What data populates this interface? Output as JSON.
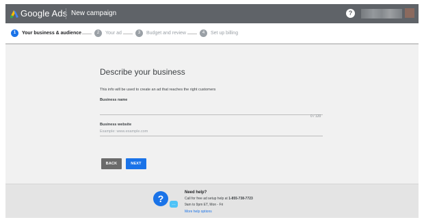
{
  "appbar": {
    "brand": "Google Ads",
    "campaign": "New campaign",
    "help_glyph": "?",
    "account_icon": "blurred-account-name",
    "logo_icon": "google-ads-logo"
  },
  "stepper": {
    "steps": [
      {
        "num": "1",
        "label": "Your business & audience",
        "active": true
      },
      {
        "num": "2",
        "label": "Your ad",
        "active": false
      },
      {
        "num": "3",
        "label": "Budget and review",
        "active": false
      },
      {
        "num": "4",
        "label": "Set up billing",
        "active": false
      }
    ]
  },
  "form": {
    "heading": "Describe your business",
    "intro": "This info will be used to create an ad that reaches the right customers",
    "business_name_label": "Business name",
    "business_name_value": "",
    "business_name_counter": "0 / 120",
    "website_label": "Business website",
    "website_placeholder": "Example: www.example.com"
  },
  "buttons": {
    "back": "BACK",
    "next": "NEXT"
  },
  "help": {
    "title": "Need help?",
    "call_prefix": "Call for free ad setup help at ",
    "phone": "1-855-738-7723",
    "hours": "9am to 9pm ET, Mon - Fri",
    "more_link": "More help options",
    "big_icon_glyph": "?",
    "small_icon_glyph": "…"
  },
  "colors": {
    "appbar": "#5f6368",
    "accent": "#1a73e8",
    "back_button": "#6b6b6b",
    "page_bg": "#f1f1f1"
  }
}
